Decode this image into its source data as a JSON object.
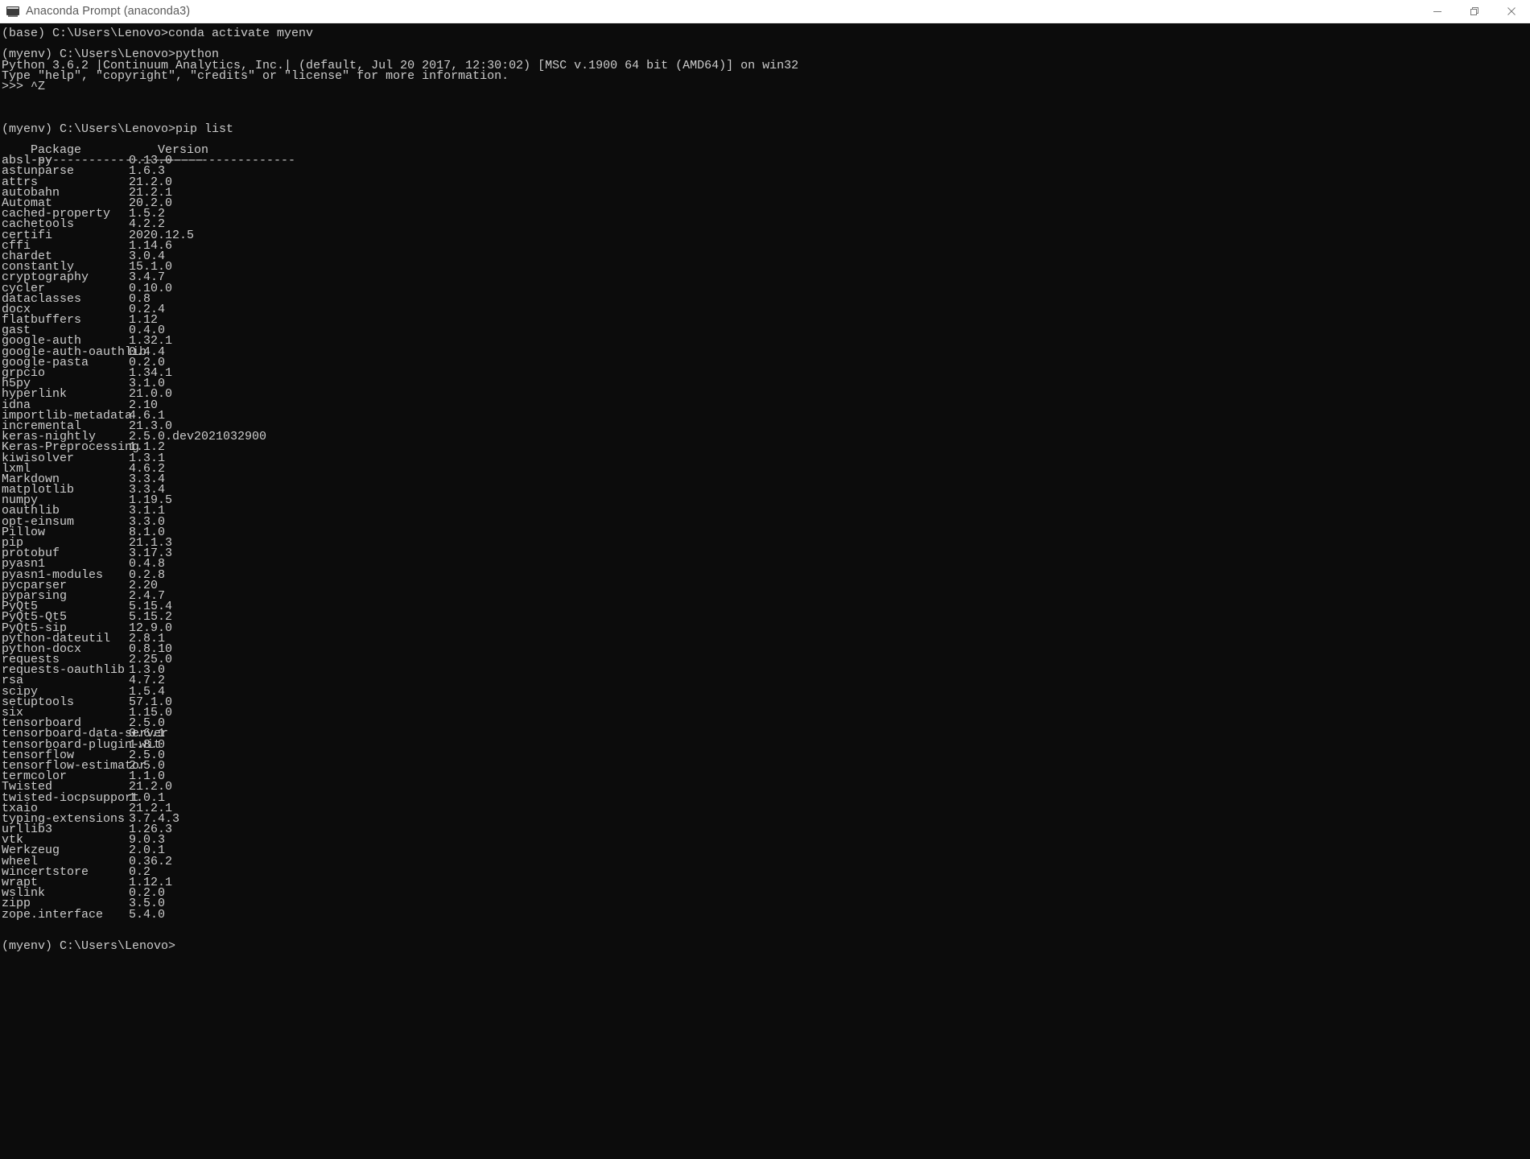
{
  "window": {
    "title": "Anaconda Prompt (anaconda3)",
    "icon": "console-icon",
    "controls": {
      "minimize": "Minimize",
      "restore": "Restore",
      "close": "Close"
    },
    "background_color": "#0c0c0c",
    "text_color": "#cccccc",
    "titlebar_color": "#ffffff"
  },
  "terminal": {
    "lines": [
      "(base) C:\\Users\\Lenovo>conda activate myenv",
      "",
      "(myenv) C:\\Users\\Lenovo>python",
      "Python 3.6.2 |Continuum Analytics, Inc.| (default, Jul 20 2017, 12:30:02) [MSC v.1900 64 bit (AMD64)] on win32",
      "Type \"help\", \"copyright\", \"credits\" or \"license\" for more information.",
      ">>> ^Z",
      "",
      "",
      "(myenv) C:\\Users\\Lenovo>pip list"
    ],
    "table": {
      "headers": [
        "Package",
        "Version"
      ],
      "separator": [
        "------------------------",
        "-------------------"
      ],
      "rows": [
        [
          "absl-py",
          "0.13.0"
        ],
        [
          "astunparse",
          "1.6.3"
        ],
        [
          "attrs",
          "21.2.0"
        ],
        [
          "autobahn",
          "21.2.1"
        ],
        [
          "Automat",
          "20.2.0"
        ],
        [
          "cached-property",
          "1.5.2"
        ],
        [
          "cachetools",
          "4.2.2"
        ],
        [
          "certifi",
          "2020.12.5"
        ],
        [
          "cffi",
          "1.14.6"
        ],
        [
          "chardet",
          "3.0.4"
        ],
        [
          "constantly",
          "15.1.0"
        ],
        [
          "cryptography",
          "3.4.7"
        ],
        [
          "cycler",
          "0.10.0"
        ],
        [
          "dataclasses",
          "0.8"
        ],
        [
          "docx",
          "0.2.4"
        ],
        [
          "flatbuffers",
          "1.12"
        ],
        [
          "gast",
          "0.4.0"
        ],
        [
          "google-auth",
          "1.32.1"
        ],
        [
          "google-auth-oauthlib",
          "0.4.4"
        ],
        [
          "google-pasta",
          "0.2.0"
        ],
        [
          "grpcio",
          "1.34.1"
        ],
        [
          "h5py",
          "3.1.0"
        ],
        [
          "hyperlink",
          "21.0.0"
        ],
        [
          "idna",
          "2.10"
        ],
        [
          "importlib-metadata",
          "4.6.1"
        ],
        [
          "incremental",
          "21.3.0"
        ],
        [
          "keras-nightly",
          "2.5.0.dev2021032900"
        ],
        [
          "Keras-Preprocessing",
          "1.1.2"
        ],
        [
          "kiwisolver",
          "1.3.1"
        ],
        [
          "lxml",
          "4.6.2"
        ],
        [
          "Markdown",
          "3.3.4"
        ],
        [
          "matplotlib",
          "3.3.4"
        ],
        [
          "numpy",
          "1.19.5"
        ],
        [
          "oauthlib",
          "3.1.1"
        ],
        [
          "opt-einsum",
          "3.3.0"
        ],
        [
          "Pillow",
          "8.1.0"
        ],
        [
          "pip",
          "21.1.3"
        ],
        [
          "protobuf",
          "3.17.3"
        ],
        [
          "pyasn1",
          "0.4.8"
        ],
        [
          "pyasn1-modules",
          "0.2.8"
        ],
        [
          "pycparser",
          "2.20"
        ],
        [
          "pyparsing",
          "2.4.7"
        ],
        [
          "PyQt5",
          "5.15.4"
        ],
        [
          "PyQt5-Qt5",
          "5.15.2"
        ],
        [
          "PyQt5-sip",
          "12.9.0"
        ],
        [
          "python-dateutil",
          "2.8.1"
        ],
        [
          "python-docx",
          "0.8.10"
        ],
        [
          "requests",
          "2.25.0"
        ],
        [
          "requests-oauthlib",
          "1.3.0"
        ],
        [
          "rsa",
          "4.7.2"
        ],
        [
          "scipy",
          "1.5.4"
        ],
        [
          "setuptools",
          "57.1.0"
        ],
        [
          "six",
          "1.15.0"
        ],
        [
          "tensorboard",
          "2.5.0"
        ],
        [
          "tensorboard-data-server",
          "0.6.1"
        ],
        [
          "tensorboard-plugin-wit",
          "1.8.0"
        ],
        [
          "tensorflow",
          "2.5.0"
        ],
        [
          "tensorflow-estimator",
          "2.5.0"
        ],
        [
          "termcolor",
          "1.1.0"
        ],
        [
          "Twisted",
          "21.2.0"
        ],
        [
          "twisted-iocpsupport",
          "1.0.1"
        ],
        [
          "txaio",
          "21.2.1"
        ],
        [
          "typing-extensions",
          "3.7.4.3"
        ],
        [
          "urllib3",
          "1.26.3"
        ],
        [
          "vtk",
          "9.0.3"
        ],
        [
          "Werkzeug",
          "2.0.1"
        ],
        [
          "wheel",
          "0.36.2"
        ],
        [
          "wincertstore",
          "0.2"
        ],
        [
          "wrapt",
          "1.12.1"
        ],
        [
          "wslink",
          "0.2.0"
        ],
        [
          "zipp",
          "3.5.0"
        ],
        [
          "zope.interface",
          "5.4.0"
        ]
      ]
    },
    "final_prompt": "(myenv) C:\\Users\\Lenovo>"
  }
}
